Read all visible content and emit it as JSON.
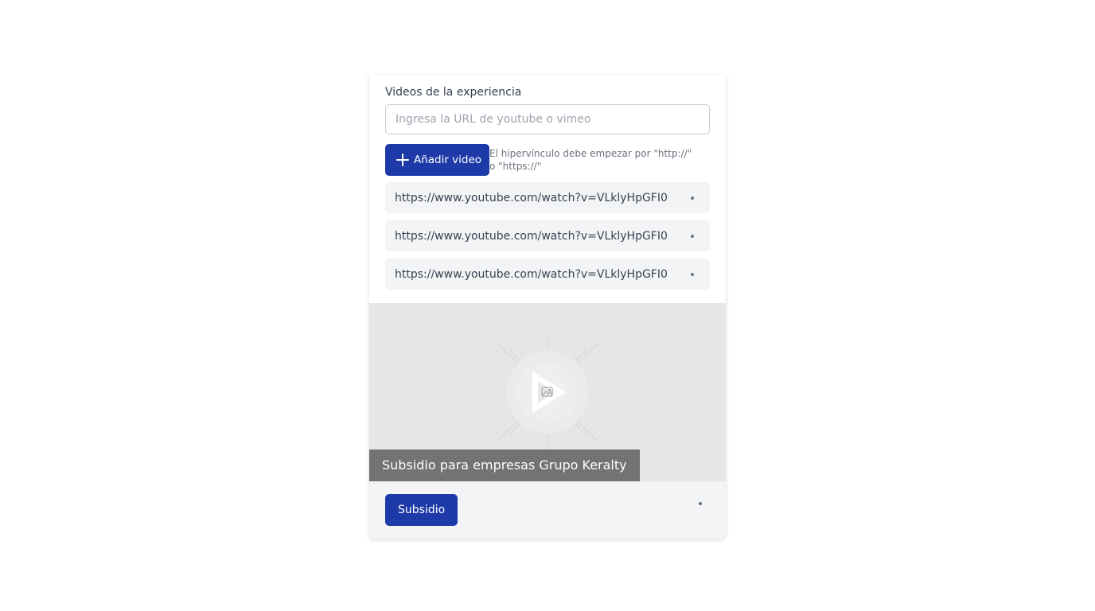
{
  "videos_section": {
    "title": "Videos de la experiencia",
    "input_placeholder": "Ingresa la URL de youtube o vimeo",
    "input_value": "",
    "add_button_label": "Añadir video",
    "hint": "El hipervínculo debe empezar por \"http://\" o \"https://\"",
    "items": [
      {
        "url": "https://www.youtube.com/watch?v=VLklyHpGFI0"
      },
      {
        "url": "https://www.youtube.com/watch?v=VLklyHpGFI0"
      },
      {
        "url": "https://www.youtube.com/watch?v=VLklyHpGFI0"
      }
    ]
  },
  "preview": {
    "caption": "Subsidio para empresas Grupo Keralty",
    "icon": "play-icon"
  },
  "footer": {
    "subsidy_button_label": "Subsidio"
  },
  "colors": {
    "primary": "#1e3aa8",
    "item_background": "#f3f4f6",
    "preview_background": "#e6e6e6",
    "caption_background": "#737373"
  }
}
